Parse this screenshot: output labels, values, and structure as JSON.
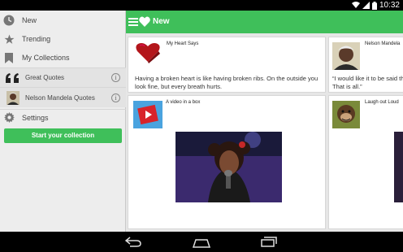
{
  "status_bar": {
    "time": "10:32",
    "icons": [
      "wifi-icon",
      "signal-icon",
      "battery-icon"
    ]
  },
  "drawer": {
    "items": [
      {
        "label": "New",
        "icon": "clock-icon"
      },
      {
        "label": "Trending",
        "icon": "star-icon"
      },
      {
        "label": "My Collections",
        "icon": "bookmark-icon"
      }
    ],
    "collections": [
      {
        "label": "Great Quotes",
        "icon": "quote-icon"
      },
      {
        "label": "Nelson Mandela Quotes",
        "icon": "portrait-thumbnail"
      }
    ],
    "settings_label": "Settings",
    "start_collection_label": "Start your collection"
  },
  "app_bar": {
    "title": "New"
  },
  "cards": [
    {
      "title": "My Heart Says",
      "text": "Having a broken heart is like having broken ribs. On the outside you look fine, but every breath hurts."
    },
    {
      "title": "Nelson Mandela",
      "text": "“I would like it to be said that I ... on earth'. That is all.”"
    },
    {
      "title": "A video in a box",
      "text": ""
    },
    {
      "title": "Laugh out Loud",
      "text": ""
    }
  ],
  "colors": {
    "accent": "#3fbf5a",
    "drawer_bg": "#ededed",
    "content_bg": "#e6e6e6"
  }
}
